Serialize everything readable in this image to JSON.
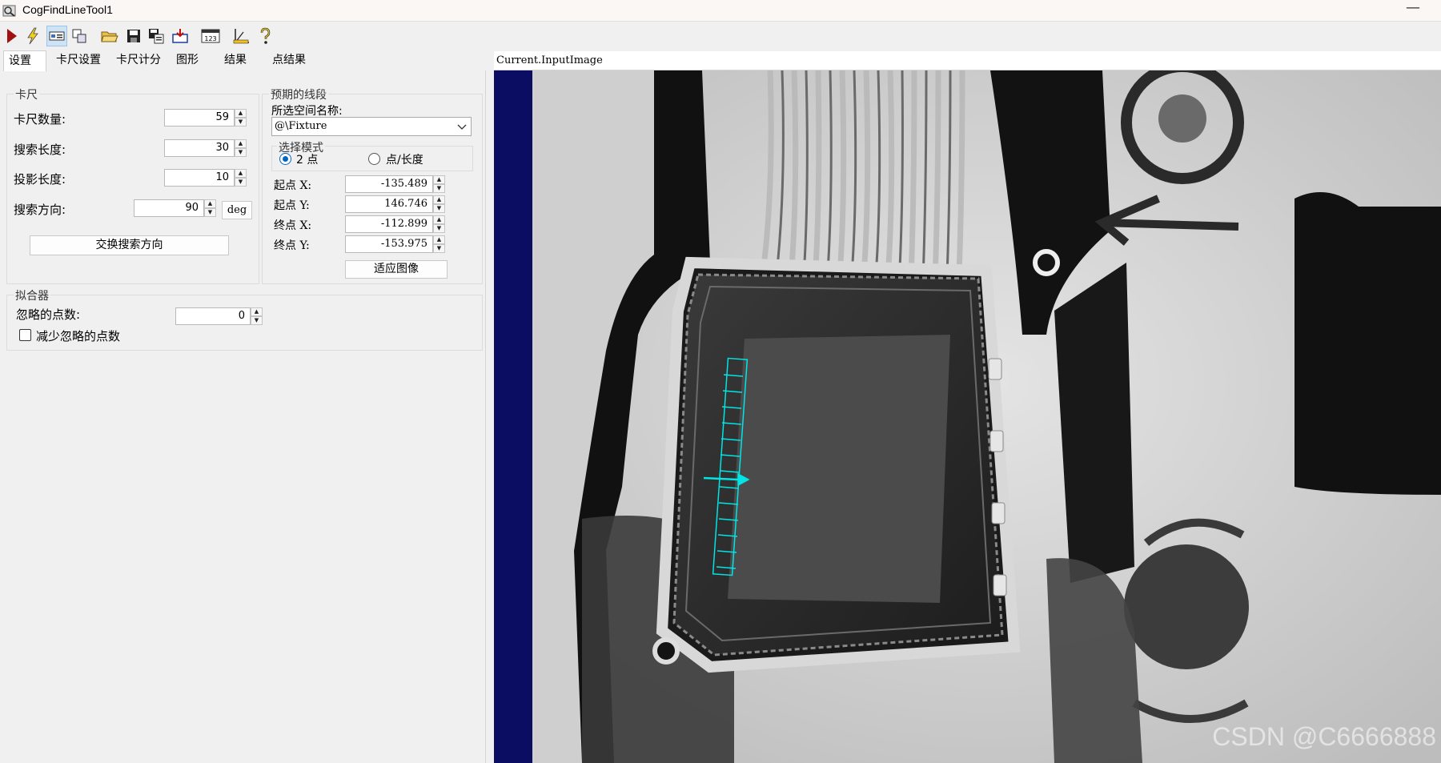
{
  "window": {
    "title": "CogFindLineTool1",
    "minimize_label": "—"
  },
  "toolbar": {
    "icons": [
      "run-icon",
      "lightning-icon",
      "image-tool-icon",
      "copy-region-icon",
      "open-folder-icon",
      "save-icon",
      "save-as-icon",
      "import-icon",
      "counter-123-icon",
      "measure-icon",
      "help-icon"
    ]
  },
  "tabs": [
    {
      "label": "设置"
    },
    {
      "label": "卡尺设置"
    },
    {
      "label": "卡尺计分"
    },
    {
      "label": "图形"
    },
    {
      "label": "结果"
    },
    {
      "label": "点结果"
    }
  ],
  "caliper": {
    "group_title": "卡尺",
    "count_label": "卡尺数量:",
    "count_value": "59",
    "search_length_label": "搜索长度:",
    "search_length_value": "30",
    "projection_length_label": "投影长度:",
    "projection_length_value": "10",
    "search_direction_label": "搜索方向:",
    "search_direction_value": "90",
    "deg_label": "deg",
    "swap_button": "交换搜索方向"
  },
  "expected_segment": {
    "group_title": "预期的线段",
    "space_label": "所选空间名称:",
    "space_value": "@\\Fixture",
    "mode_group_title": "选择模式",
    "mode_two_points": "2 点",
    "mode_point_length": "点/长度",
    "start_x_label": "起点 X:",
    "start_x_value": "-135.489",
    "start_y_label": "起点 Y:",
    "start_y_value": "146.746",
    "end_x_label": "终点 X:",
    "end_x_value": "-112.899",
    "end_y_label": "终点 Y:",
    "end_y_value": "-153.975",
    "fit_button": "适应图像"
  },
  "fitter": {
    "group_title": "拟合器",
    "ignore_label": "忽略的点数:",
    "ignore_value": "0",
    "reduce_label": "减少忽略的点数"
  },
  "viewer": {
    "label": "Current.InputImage",
    "watermark": "CSDN @C6666888"
  },
  "colors": {
    "caliper_overlay": "#00e5e5",
    "viewer_background": "#0b0d63",
    "radio_accent": "#0067c0"
  }
}
